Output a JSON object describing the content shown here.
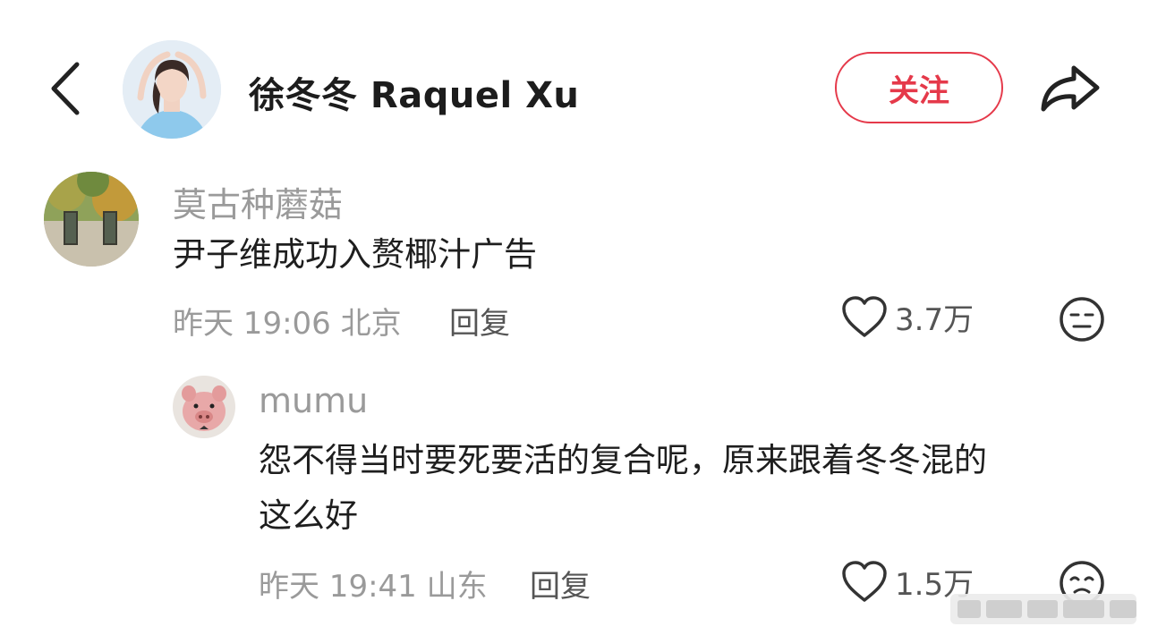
{
  "header": {
    "title": "徐冬冬 Raquel Xu",
    "follow_label": "关注",
    "icons": {
      "back": "chevron-left-icon",
      "share": "share-arrow-icon"
    },
    "accent_color": "#e5394a"
  },
  "comments": [
    {
      "username": "莫古种蘑菇",
      "text": "尹子维成功入赘椰汁广告",
      "time": "昨天 19:06",
      "location": "北京",
      "reply_label": "回复",
      "likes": "3.7万"
    },
    {
      "username": "mumu",
      "text_lines": [
        "怨不得当时要死要活的复合呢，原来跟着冬冬混的",
        "这么好"
      ],
      "time": "昨天 19:41",
      "location": "山东",
      "reply_label": "回复",
      "likes": "1.5万"
    }
  ]
}
